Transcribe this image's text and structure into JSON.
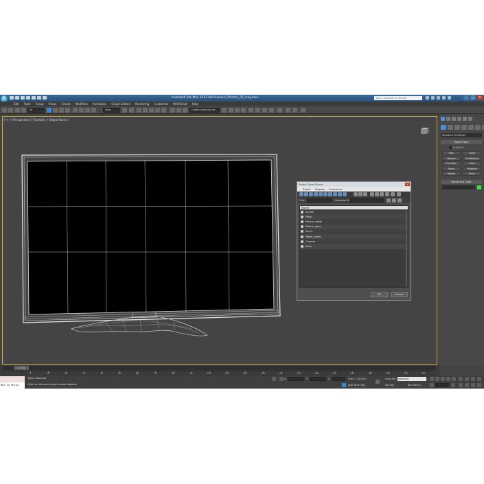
{
  "window": {
    "title": "Autodesk 3ds Max  2012 x64      Generic_Plasma_TV_vray.max",
    "search_placeholder": "Type a keyword or phrase"
  },
  "menu": [
    "Edit",
    "Tools",
    "Group",
    "Views",
    "Create",
    "Modifiers",
    "Animation",
    "Graph Editors",
    "Rendering",
    "Customize",
    "MAXScript",
    "Help"
  ],
  "toolbar": {
    "filter_dropdown": "All",
    "reference_dropdown": "View",
    "selection_set": "Create Selection Se"
  },
  "viewport": {
    "label": "[ + ] [ Perspective ] [ Realistic + Edged Faces ]"
  },
  "command_panel": {
    "dropdown": "Standard Primitives",
    "object_type_header": "Object Type",
    "autogrid_label": "AutoGrid",
    "objects": [
      "Box",
      "Cone",
      "Sphere",
      "GeoSphere",
      "Cylinder",
      "Tube",
      "Torus",
      "Pyramid",
      "Teapot",
      "Plane"
    ],
    "name_color_header": "Name and Color",
    "accent_color": "#3ddc49"
  },
  "dialog": {
    "title": "Select From Scene",
    "menu": [
      "Select",
      "Display",
      "Customize"
    ],
    "find_label": "Find:",
    "selection_set_label": "Selection Set:",
    "column_header": "Name",
    "items": [
      "Screen",
      "Plate",
      "Plastic_matte",
      "Plastic_gloss",
      "Panel",
      "Metal_matte",
      "Chrome",
      "Body"
    ],
    "ok_label": "OK",
    "cancel_label": "Cancel"
  },
  "timeline": {
    "current_frame": "0 / 100",
    "ticks": [
      "0",
      "10",
      "20",
      "30",
      "40",
      "50",
      "60",
      "70",
      "80",
      "90",
      "100",
      "110",
      "120",
      "130",
      "140",
      "150",
      "160",
      "170",
      "180",
      "190",
      "200",
      "210",
      "220"
    ]
  },
  "status": {
    "maxscript_label": "Max to Physc",
    "selection": "None Selected",
    "prompt": "Click or click-and-drag to select objects",
    "x_label": "X:",
    "y_label": "Y:",
    "z_label": "Z:",
    "grid": "Grid = 10,0cm",
    "add_time_tag": "Add Time Tag",
    "auto_key": "Auto Key",
    "set_key": "Set Key",
    "selected_dropdown": "Selected",
    "key_filters": "Key Filters..."
  }
}
